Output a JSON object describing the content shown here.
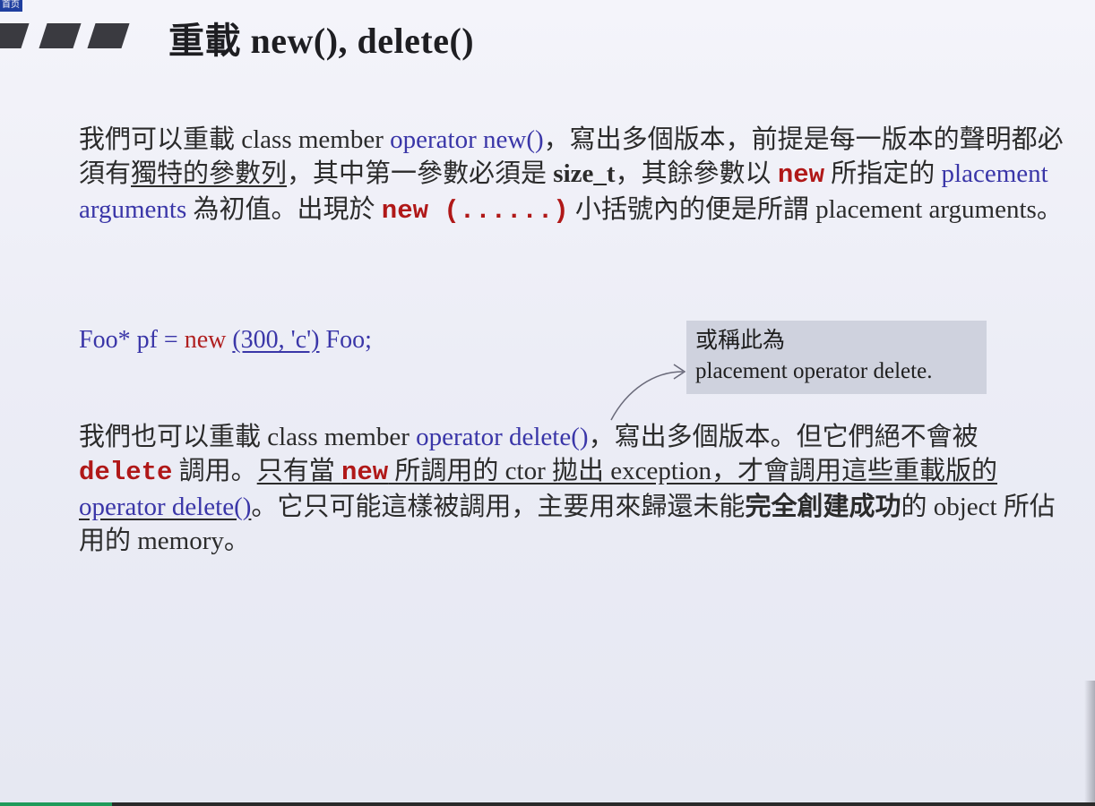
{
  "corner_tag": "首页",
  "title": "重載 new(), delete()",
  "para1": {
    "t1": "我們可以重載 class member ",
    "t2": "operator new()",
    "t3": "，寫出多個版本，前提是每一版本的聲明都必須有",
    "t4": "獨特的參數列",
    "t5": "，其中第一參數必須是 ",
    "t6": "size_t",
    "t7": "，其餘參數以 ",
    "t8": "new",
    "t9": " 所指定的 ",
    "t10": "placement arguments",
    "t11": " 為初值。出現於 ",
    "t12": "new (......)",
    "t13": " 小括號內的便是所謂 placement arguments。"
  },
  "code": {
    "lhs": "Foo* pf = ",
    "kw": "new",
    "args": "(300, 'c')",
    "rhs": " Foo;"
  },
  "annotation": {
    "line1": "或稱此為",
    "line2": "placement operator delete."
  },
  "para2": {
    "t1": "我們也可以重載 class member ",
    "t2": "operator delete()",
    "t3": "，寫出多個版本。但它們絕不會被 ",
    "t4": "delete",
    "t5": " 調用。",
    "t6": "只有當 ",
    "t7": "new",
    "t8": " 所調用的 ctor 拋出 exception，才會調用這些重載版的 ",
    "t9": "operator delete()",
    "t10": "。它只可能這樣被調用，主要用來歸還未能",
    "t11": "完全創建成功",
    "t12": "的 object 所佔用的 memory。"
  },
  "colors": {
    "blue": "#3a36a8",
    "code_red": "#b01818",
    "annotation_bg": "#cfd2de",
    "header_bar": "#3a3a40"
  }
}
